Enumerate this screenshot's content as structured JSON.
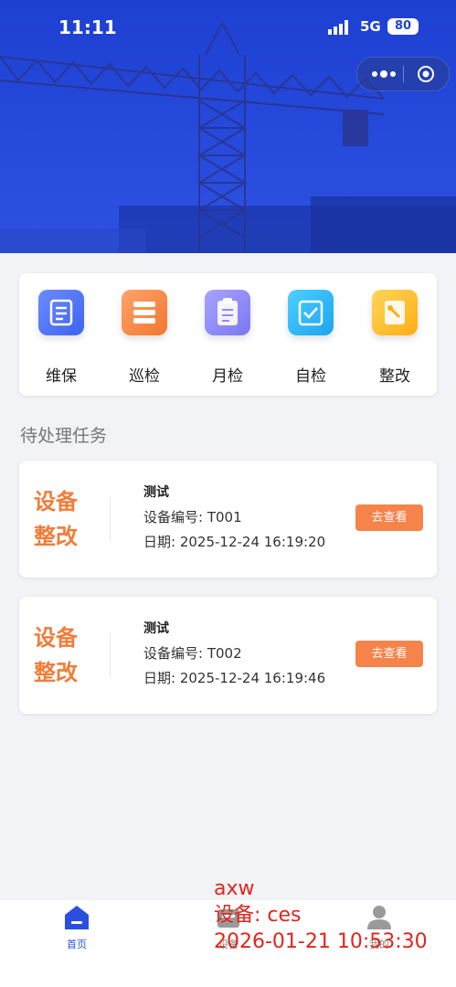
{
  "status_bar": {
    "time": "11:11",
    "network": "5G",
    "battery": "80"
  },
  "menu": [
    {
      "label": "维保",
      "icon": "maintenance-icon",
      "color_from": "#6b8cff",
      "color_to": "#3d63f0"
    },
    {
      "label": "巡检",
      "icon": "inspection-list-icon",
      "color_from": "#ffa46b",
      "color_to": "#f3762f"
    },
    {
      "label": "月检",
      "icon": "clipboard-icon",
      "color_from": "#a7a3ff",
      "color_to": "#7b78f2"
    },
    {
      "label": "自检",
      "icon": "self-check-icon",
      "color_from": "#4fd0ff",
      "color_to": "#1aa3f0"
    },
    {
      "label": "整改",
      "icon": "rectify-icon",
      "color_from": "#ffd55a",
      "color_to": "#ffae14"
    }
  ],
  "section_title": "待处理任务",
  "tasks": [
    {
      "type_line1": "设备",
      "type_line2": "整改",
      "name": "测试",
      "code": "设备编号: T001",
      "date": "日期: 2025-12-24 16:19:20",
      "button": "去查看"
    },
    {
      "type_line1": "设备",
      "type_line2": "整改",
      "name": "测试",
      "code": "设备编号: T002",
      "date": "日期: 2025-12-24 16:19:46",
      "button": "去查看"
    }
  ],
  "tabbar": [
    {
      "label": "首页",
      "icon": "home-icon",
      "active": true
    },
    {
      "label": "设备",
      "icon": "device-icon",
      "active": false
    },
    {
      "label": "我的",
      "icon": "profile-icon",
      "active": false
    }
  ],
  "watermark": {
    "line1": "axw",
    "line2": "设备: ces",
    "line3": "2026-01-21 10:53:30"
  },
  "colors": {
    "primary": "#2a4fe0",
    "accent": "#f5834a",
    "task_type": "#f07d3a",
    "watermark": "#e0261b"
  }
}
